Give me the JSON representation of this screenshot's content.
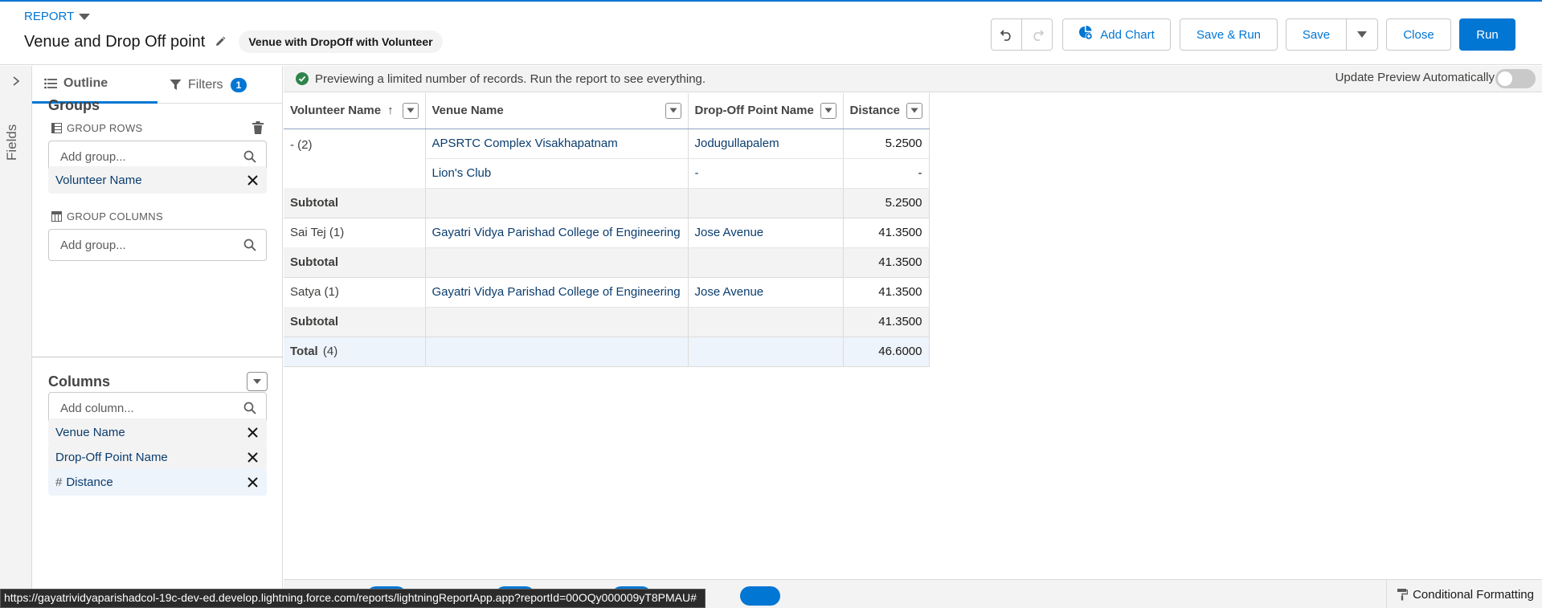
{
  "header": {
    "report_type_label": "REPORT",
    "report_title": "Venue and Drop Off point",
    "report_type_pill": "Venue with DropOff with Volunteer",
    "buttons": {
      "add_chart": "Add Chart",
      "save_run": "Save & Run",
      "save": "Save",
      "close": "Close",
      "run": "Run"
    }
  },
  "side_rail": {
    "label": "Fields"
  },
  "panel": {
    "tabs": {
      "outline": "Outline",
      "filters": "Filters",
      "filters_count": "1"
    },
    "groups": {
      "title": "Groups",
      "group_rows_label": "GROUP ROWS",
      "group_rows_placeholder": "Add group...",
      "row_groups": [
        "Volunteer Name"
      ],
      "group_columns_label": "GROUP COLUMNS",
      "group_columns_placeholder": "Add group..."
    },
    "columns": {
      "title": "Columns",
      "placeholder": "Add column...",
      "items": [
        "Venue Name",
        "Drop-Off Point Name",
        "Distance"
      ],
      "numeric_marker": "#"
    }
  },
  "preview": {
    "message": "Previewing a limited number of records. Run the report to see everything.",
    "auto_update_label": "Update Preview Automatically",
    "auto_update_on": false
  },
  "table": {
    "headers": [
      "Volunteer Name",
      "Venue Name",
      "Drop-Off Point Name",
      "Distance"
    ],
    "sort_indicator": "↑",
    "groups": [
      {
        "label": "- (2)",
        "rows": [
          [
            "APSRTC Complex Visakhapatnam",
            "Jodugullapalem",
            "5.2500"
          ],
          [
            "Lion's Club",
            "-",
            "-"
          ]
        ],
        "subtotal_label": "Subtotal",
        "subtotal": "5.2500"
      },
      {
        "label": "Sai Tej (1)",
        "rows": [
          [
            "Gayatri Vidya Parishad College of Engineering",
            "Jose Avenue",
            "41.3500"
          ]
        ],
        "subtotal_label": "Subtotal",
        "subtotal": "41.3500"
      },
      {
        "label": "Satya (1)",
        "rows": [
          [
            "Gayatri Vidya Parishad College of Engineering",
            "Jose Avenue",
            "41.3500"
          ]
        ],
        "subtotal_label": "Subtotal",
        "subtotal": "41.3500"
      }
    ],
    "total_label": "Total",
    "total_count": "(4)",
    "total": "46.6000"
  },
  "footer": {
    "conditional_formatting": "Conditional Formatting",
    "status_url": "https://gayatrividyaparishadcol-19c-dev-ed.develop.lightning.force.com/reports/lightningReportApp.app?reportId=00OQy000009yT8PMAU#"
  },
  "colors": {
    "brand": "#0176d3",
    "success": "#2e844a"
  }
}
